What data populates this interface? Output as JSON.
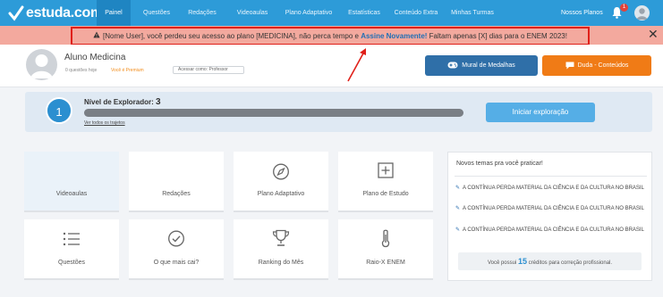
{
  "nav": {
    "brand": "estuda.com",
    "items": [
      {
        "label": "Painel",
        "active": true
      },
      {
        "label": "Questões",
        "active": false
      },
      {
        "label": "Redações",
        "active": false
      },
      {
        "label": "Videoaulas",
        "active": false
      },
      {
        "label": "Plano Adaptativo",
        "active": false
      },
      {
        "label": "Estatísticas",
        "active": false
      },
      {
        "label": "Conteúdo Extra",
        "active": false
      },
      {
        "label": "Minhas Turmas",
        "active": false
      }
    ],
    "plans_label": "Nossos Planos",
    "notification_count": "1",
    "colors": {
      "bar": "#2d9bd8",
      "active": "#1f85c2"
    }
  },
  "alert": {
    "text_before": "[Nome User], você perdeu seu acesso ao plano [MEDICINA], não perca tempo e ",
    "link": "Assine Novamente!",
    "text_after": " Faltam apenas [X] dias para o ENEM 2023!",
    "close": "✕",
    "warning_icon": "warning-icon"
  },
  "profile": {
    "name": "Aluno Medicina",
    "questions_today": "0 questões hoje",
    "premium": "Você é Premium",
    "act_as": "Acessar como: Professor"
  },
  "buttons": {
    "medals": "Mural de Medalhas",
    "doubt": "Duda - Conteúdos"
  },
  "explorer": {
    "level_number": "1",
    "level_title": "Nível de Explorador:",
    "level_value": "3",
    "trails_link": "Ver todos os trajetos",
    "start_button": "Iniciar exploração",
    "progress": 1.0
  },
  "tiles": [
    {
      "label": "Videoaulas",
      "icon": "none"
    },
    {
      "label": "Redações",
      "icon": "none"
    },
    {
      "label": "Plano Adaptativo",
      "icon": "compass-icon"
    },
    {
      "label": "Plano de Estudo",
      "icon": "plus-square-icon"
    },
    {
      "label": "Questões",
      "icon": "list-icon"
    },
    {
      "label": "O que mais cai?",
      "icon": "check-circle-icon"
    },
    {
      "label": "Ranking do Mês",
      "icon": "trophy-icon"
    },
    {
      "label": "Raio-X ENEM",
      "icon": "thermometer-icon"
    }
  ],
  "topics_panel": {
    "title": "Novos temas pra você praticar!",
    "topics": [
      "A CONTÍNUA PERDA MATERIAL DA CIÊNCIA E DA CULTURA NO BRASIL",
      "A CONTÍNUA PERDA MATERIAL DA CIÊNCIA E DA CULTURA NO BRASIL",
      "A CONTÍNUA PERDA MATERIAL DA CIÊNCIA E DA CULTURA NO BRASIL"
    ],
    "credits_before": "Você possui ",
    "credits_number": "15",
    "credits_after": " créditos para correção profissional."
  }
}
